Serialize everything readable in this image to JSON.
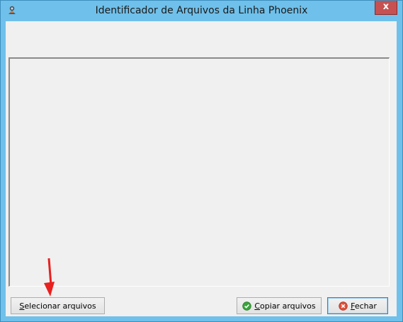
{
  "window": {
    "title": "Identificador de Arquivos da Linha Phoenix",
    "close_glyph": "x",
    "icon": "phoenix-app-icon"
  },
  "buttons": {
    "select": {
      "mnemonic": "S",
      "rest": "elecionar arquivos"
    },
    "copy": {
      "mnemonic": "C",
      "rest": "opiar arquivos",
      "icon": "check-circle-icon",
      "icon_color": "#3aa53a"
    },
    "close": {
      "mnemonic": "F",
      "rest": "echar",
      "icon": "cancel-circle-icon",
      "icon_color": "#e0503a"
    }
  },
  "annotation": {
    "arrow_color": "#e8201f"
  },
  "colors": {
    "titlebar": "#6fc0ea",
    "client": "#f0f0f0",
    "close_button": "#c75050"
  }
}
